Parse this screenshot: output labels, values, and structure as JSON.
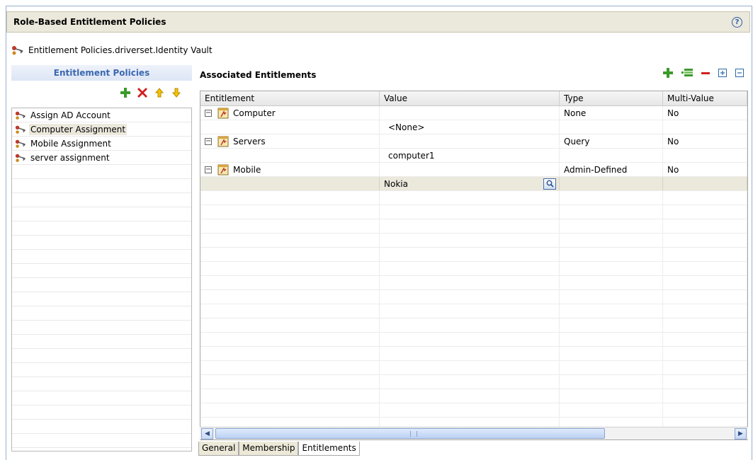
{
  "header": {
    "title": "Role-Based Entitlement Policies",
    "help_icon": "help-icon"
  },
  "breadcrumb": {
    "text": "Entitlement Policies.driverset.Identity Vault",
    "icon": "policy-icon"
  },
  "left_panel": {
    "title": "Entitlement Policies",
    "toolbar": {
      "add": "add-icon",
      "delete": "delete-icon",
      "up": "move-up-icon",
      "down": "move-down-icon"
    },
    "items": [
      {
        "label": "Assign AD Account",
        "selected": false
      },
      {
        "label": "Computer Assignment",
        "selected": true
      },
      {
        "label": "Mobile Assignment",
        "selected": false
      },
      {
        "label": "server assignment",
        "selected": false
      }
    ]
  },
  "right_panel": {
    "title": "Associated Entitlements",
    "toolbar": [
      "add-icon",
      "add-value-icon",
      "remove-icon",
      "expand-all-icon",
      "collapse-all-icon"
    ],
    "columns": [
      "Entitlement",
      "Value",
      "Type",
      "Multi-Value"
    ],
    "rows": [
      {
        "entitlement": "Computer",
        "value": "",
        "type": "None",
        "multi": "No"
      },
      {
        "entitlement": "",
        "value": "<None>",
        "type": "",
        "multi": ""
      },
      {
        "entitlement": "Servers",
        "value": "",
        "type": "Query",
        "multi": "No"
      },
      {
        "entitlement": "",
        "value": "computer1",
        "type": "",
        "multi": ""
      },
      {
        "entitlement": "Mobile",
        "value": "",
        "type": "Admin-Defined",
        "multi": "No"
      },
      {
        "entitlement": "",
        "value": "Nokia",
        "type": "",
        "multi": ""
      }
    ]
  },
  "tabs": [
    "General",
    "Membership",
    "Entitlements"
  ],
  "active_tab": "Entitlements",
  "colors": {
    "header_bg": "#ebe8dc",
    "accent": "#3b68b0",
    "add": "#3a9a2a",
    "delete": "#d22020",
    "arrow": "#e8a800"
  }
}
